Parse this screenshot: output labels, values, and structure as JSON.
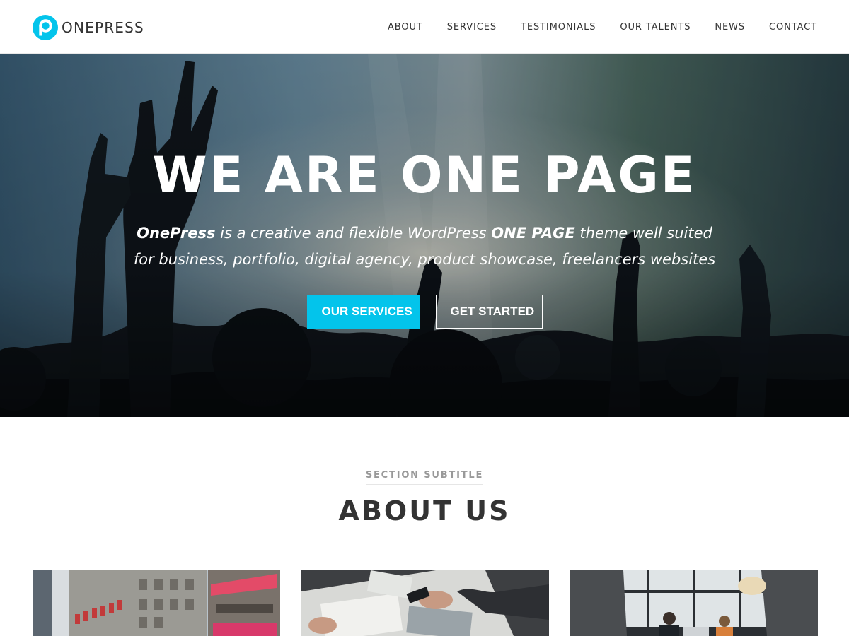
{
  "header": {
    "logo_text": "ONEPRESS",
    "logo_icon": "p-circle-logo",
    "brand_color": "#03c4eb",
    "nav": [
      {
        "label": "ABOUT"
      },
      {
        "label": "SERVICES"
      },
      {
        "label": "TESTIMONIALS"
      },
      {
        "label": "OUR TALENTS"
      },
      {
        "label": "NEWS"
      },
      {
        "label": "CONTACT"
      }
    ]
  },
  "hero": {
    "title": "WE ARE ONE PAGE",
    "text": {
      "brand": "OnePress",
      "part1": " is a creative and flexible WordPress ",
      "emph": "ONE PAGE",
      "part2": " theme well suited",
      "line2": "for business, portfolio, digital agency, product showcase, freelancers websites"
    },
    "buttons": {
      "primary": "OUR SERVICES",
      "secondary": "GET STARTED"
    }
  },
  "about": {
    "subtitle": "SECTION SUBTITLE",
    "title": "ABOUT US",
    "cards": [
      {
        "image": "city-building-photo"
      },
      {
        "image": "desk-paperwork-photo"
      },
      {
        "image": "office-meeting-photo"
      }
    ]
  }
}
